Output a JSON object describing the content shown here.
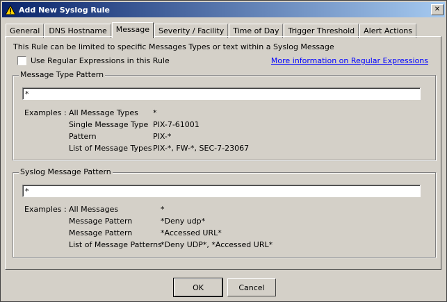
{
  "window": {
    "title": "Add New Syslog Rule"
  },
  "tabs": [
    {
      "label": "General"
    },
    {
      "label": "DNS Hostname"
    },
    {
      "label": "Message"
    },
    {
      "label": "Severity / Facility"
    },
    {
      "label": "Time of Day"
    },
    {
      "label": "Trigger Threshold"
    },
    {
      "label": "Alert Actions"
    }
  ],
  "intro": "This Rule can be limited to specific Messages Types or text within a Syslog Message",
  "regex_checkbox": {
    "label": "Use Regular Expressions in this Rule",
    "checked": false
  },
  "regex_link": "More information on Regular Expressions",
  "message_type": {
    "title": "Message Type Pattern",
    "value": "*",
    "examples_label": "Examples :",
    "examples": [
      {
        "name": "All Message Types",
        "value": "*"
      },
      {
        "name": "Single Message Type",
        "value": "PIX-7-61001"
      },
      {
        "name": "Pattern",
        "value": "PIX-*"
      },
      {
        "name": "List of Message Types",
        "value": "PIX-*, FW-*, SEC-7-23067"
      }
    ]
  },
  "syslog_message": {
    "title": "Syslog Message Pattern",
    "value": "*",
    "examples_label": "Examples :",
    "examples": [
      {
        "name": "All Messages",
        "value": "*"
      },
      {
        "name": "Message Pattern",
        "value": "*Deny udp*"
      },
      {
        "name": "Message Pattern",
        "value": "*Accessed URL*"
      },
      {
        "name": "List of Message Patterns",
        "value": "*Deny UDP*, *Accessed URL*"
      }
    ]
  },
  "buttons": {
    "ok": "OK",
    "cancel": "Cancel"
  }
}
